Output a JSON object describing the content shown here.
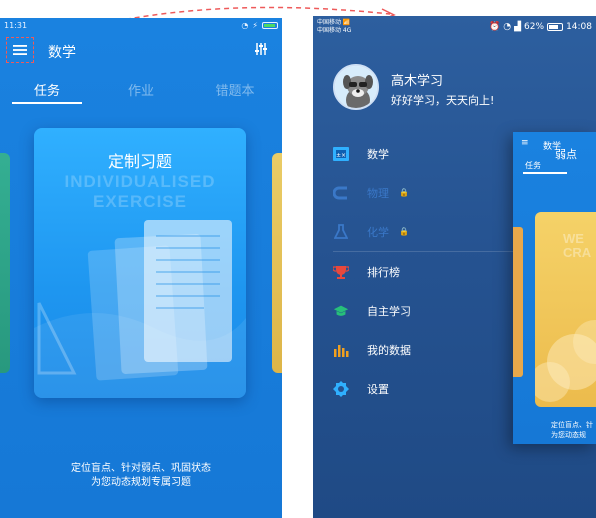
{
  "left_screen": {
    "status_time": "11:31",
    "title": "数学",
    "tabs": [
      "任务",
      "作业",
      "错题本"
    ],
    "active_tab": 0,
    "card_title": "定制习题",
    "card_watermark_line1": "INDIVIDUALISED",
    "card_watermark_line2": "EXERCISE",
    "caption_line1": "定位盲点、针对弱点、巩固状态",
    "caption_line2": "为您动态规划专属习题",
    "icons": [
      "menu-icon",
      "filter-icon"
    ]
  },
  "right_screen": {
    "carrier_line1": "中国移动 📶",
    "carrier_line2": "中国移动 4G",
    "battery": "62%",
    "time": "14:08",
    "profile": {
      "name": "高木学习",
      "motto": "好好学习，天天向上!"
    },
    "menu_items": [
      {
        "label": "数学",
        "icon": "math-book-icon",
        "locked": false
      },
      {
        "label": "物理",
        "icon": "magnet-icon",
        "locked": true
      },
      {
        "label": "化学",
        "icon": "flask-icon",
        "locked": true
      },
      {
        "label": "排行榜",
        "icon": "trophy-icon",
        "locked": false
      },
      {
        "label": "自主学习",
        "icon": "graduation-cap-icon",
        "locked": false
      },
      {
        "label": "我的数据",
        "icon": "bar-chart-icon",
        "locked": false
      },
      {
        "label": "设置",
        "icon": "gear-icon",
        "locked": false
      }
    ],
    "preview": {
      "title": "数学",
      "tab": "任务",
      "card_title": "弱点",
      "card_watermark_line1": "WE",
      "card_watermark_line2": "CRA",
      "caption_line1": "定位盲点、针",
      "caption_line2": "为您动态规"
    }
  },
  "colors": {
    "accent_blue": "#1a82e0",
    "drawer_bg": "#255290",
    "highlight_red": "#ee5a5a"
  }
}
